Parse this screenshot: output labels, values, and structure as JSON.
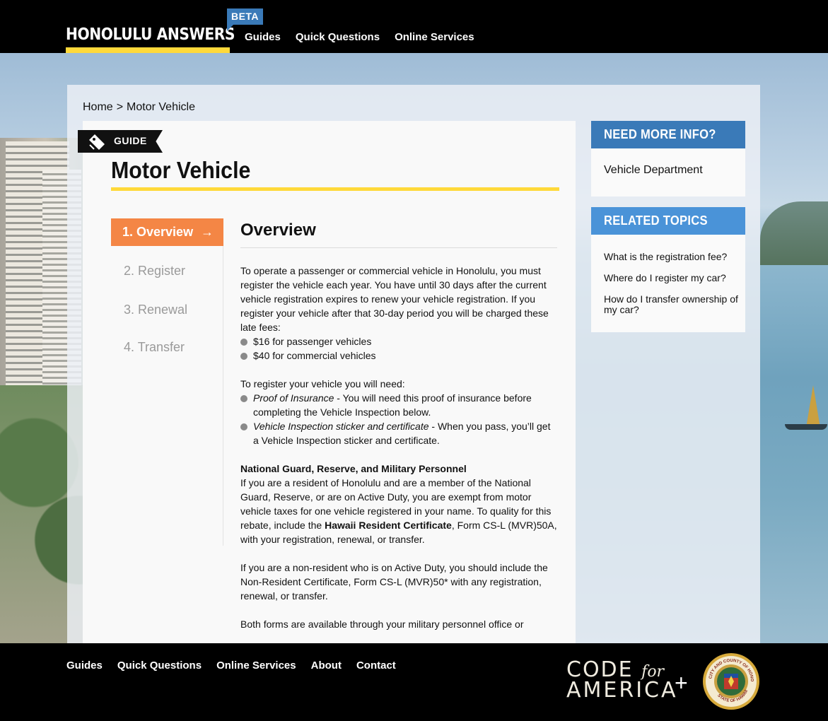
{
  "header": {
    "brand": "HONOLULU ANSWERS",
    "beta": "BETA",
    "nav": [
      "Guides",
      "Quick Questions",
      "Online Services"
    ]
  },
  "breadcrumb": {
    "home": "Home",
    "separator": ">",
    "current": "Motor Vehicle"
  },
  "guide": {
    "tag": "GUIDE",
    "title": "Motor Vehicle"
  },
  "steps": {
    "active": "1. Overview",
    "arrow": "→",
    "items": [
      "2. Register",
      "3. Renewal",
      "4. Transfer"
    ]
  },
  "content": {
    "section_title": "Overview",
    "intro": "To operate a passenger or commercial vehicle in Honolulu, you must register the vehicle each year. You have until 30 days after the current vehicle registration expires to renew your vehicle registration. If you register your vehicle after that 30-day period you will be charged these late fees:",
    "fees": [
      "$16 for passenger vehicles",
      "$40 for commercial vehicles"
    ],
    "need_intro": "To register your vehicle you will need:",
    "needs": [
      {
        "term": "Proof of Insurance",
        "text": " - You will need this proof of insurance before completing the Vehicle Inspection below."
      },
      {
        "term": "Vehicle Inspection sticker and certificate",
        "text": " - When you pass, you’ll get a Vehicle Inspection sticker and certificate."
      }
    ],
    "military_heading": "National Guard, Reserve, and Military Personnel",
    "military_p1_a": "If you are a resident of Honolulu and are a member of the National Guard, Reserve, or are on Active Duty, you are exempt from motor vehicle taxes for one vehicle registered in your name. To quality for this rebate, include the ",
    "military_p1_b": "Hawaii Resident Certificate",
    "military_p1_c": ", Form CS-L (MVR)50A,  with your registration, renewal, or transfer.",
    "military_p2": "If you are a non-resident who is on Active Duty, you should include the Non-Resident Certificate, Form CS-L (MVR)50* with any registration, renewal, or transfer.",
    "military_p3": "Both forms are available through your military personnel office or"
  },
  "sidebar": {
    "more_info": {
      "heading": "NEED MORE INFO?",
      "link": "Vehicle Department"
    },
    "related": {
      "heading": "RELATED TOPICS",
      "links": [
        "What is the registration fee?",
        "Where do I register my car?",
        "How do I transfer ownership of my car?"
      ]
    }
  },
  "footer": {
    "nav": [
      "Guides",
      "Quick Questions",
      "Online Services",
      "About",
      "Contact"
    ],
    "cfa_line1": "CODE",
    "cfa_for": "for",
    "cfa_line2": "AMERICA",
    "plus": "+",
    "seal_text_top": "CITY AND COUNTY OF HONOLULU",
    "seal_text_bottom": "STATE OF HAWAII"
  },
  "colors": {
    "accent_yellow": "#ffd93a",
    "step_orange": "#f48645",
    "beta_blue": "#3a7ab8",
    "related_blue": "#4a93d8"
  }
}
